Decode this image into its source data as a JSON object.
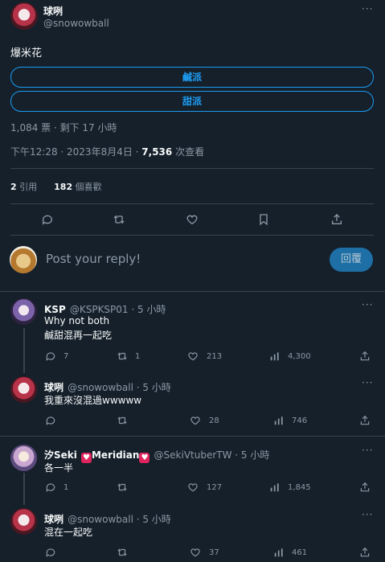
{
  "tweet": {
    "author_name": "球咧",
    "author_handle": "@snowowball",
    "text": "爆米花",
    "poll": {
      "options": [
        "鹹派",
        "甜派"
      ],
      "summary": "1,084 票 · 剩下 17 小時"
    },
    "time": "下午12:28 · 2023年8月4日 · ",
    "views_count": "7,536",
    "views_label": " 次查看",
    "retweets_count": "2",
    "retweets_label": " 引用",
    "likes_count": "182",
    "likes_label": " 個喜歡"
  },
  "composer": {
    "placeholder": "Post your reply!",
    "button": "回覆"
  },
  "replies": [
    {
      "name": "KSP",
      "handle_time": "@KSPKSP01 · 5 小時",
      "lines": [
        "Why not both",
        "鹹甜混再一起吃"
      ],
      "stats": {
        "reply": "7",
        "retweet": "1",
        "like": "213",
        "views": "4,300"
      }
    },
    {
      "name": "球咧",
      "handle_time": "@snowowball · 5 小時",
      "lines": [
        "我重來沒混過wwwww"
      ],
      "stats": {
        "reply": "",
        "retweet": "",
        "like": "28",
        "views": "746"
      }
    },
    {
      "name": "汐Seki",
      "name_suffix": "Meridian",
      "handle_time": "@SekiVtuberTW · 5 小時",
      "lines": [
        "各一半"
      ],
      "stats": {
        "reply": "1",
        "retweet": "",
        "like": "127",
        "views": "1,845"
      }
    },
    {
      "name": "球咧",
      "handle_time": "@snowowball · 5 小時",
      "lines": [
        "混在一起吃"
      ],
      "stats": {
        "reply": "",
        "retweet": "",
        "like": "37",
        "views": "461"
      }
    }
  ],
  "colors": {
    "background": "#15202b",
    "accent": "#1d9bf0",
    "muted": "#8b98a5",
    "divider": "#38444d"
  },
  "icons": {
    "more": "···",
    "heart": "heart-icon"
  }
}
